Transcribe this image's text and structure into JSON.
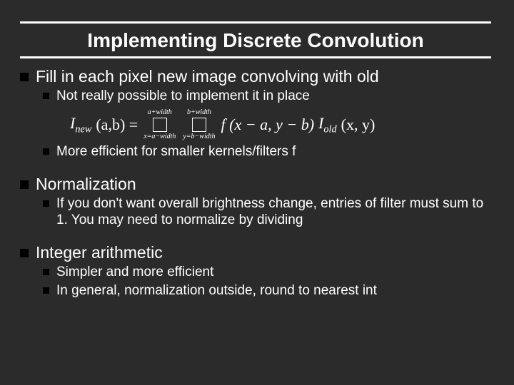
{
  "title": "Implementing Discrete Convolution",
  "bullets": {
    "b1": "Fill in each pixel new image convolving with old",
    "b1a": "Not really possible to implement it in place",
    "b1b": "More efficient for smaller kernels/filters f",
    "b2": "Normalization",
    "b2a": "If you don't want overall brightness change, entries of filter must sum to 1.  You may need to normalize by dividing",
    "b3": "Integer arithmetic",
    "b3a": "Simpler and more efficient",
    "b3b": "In general, normalization outside, round to nearest int"
  },
  "formula": {
    "lhs_I": "I",
    "lhs_new": "new",
    "lhs_args": "(a,b) =",
    "sum1_top": "a+width",
    "sum1_bot": "x=a−width",
    "sum2_top": "b+width",
    "sum2_bot": "y=b−width",
    "f_part": "f (x − a, y − b)",
    "rhs_I": "I",
    "rhs_old": "old",
    "rhs_args": "(x, y)"
  }
}
